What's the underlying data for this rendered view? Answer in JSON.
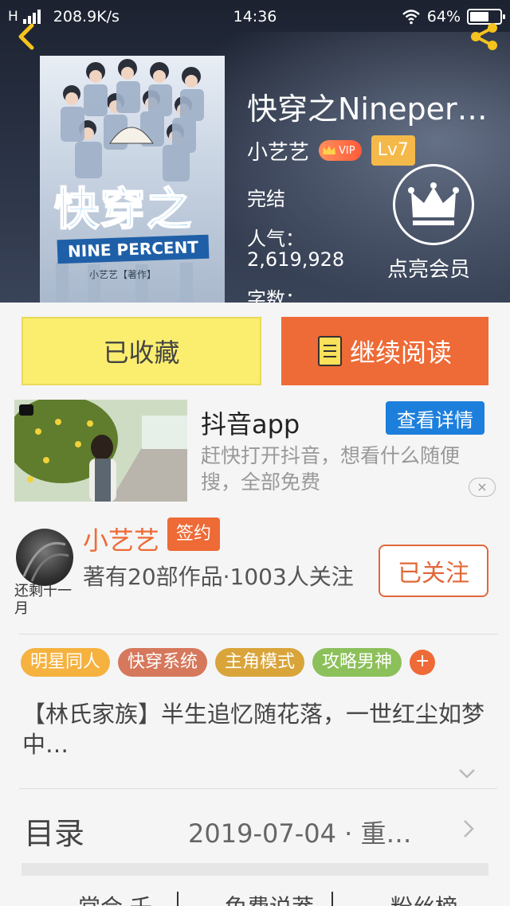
{
  "status_bar": {
    "network": "H",
    "speed": "208.9K/s",
    "time": "14:36",
    "battery": "64%",
    "battery_level": 0.64
  },
  "header": {
    "back_icon": "chevron-left-icon",
    "share_icon": "share-icon",
    "cover": {
      "title": "快穿之",
      "band": "NINE PERCENT",
      "author": "小艺艺【著作】"
    },
    "title": "快穿之Nineper…",
    "author": "小艺艺",
    "vip": "VIP",
    "level": "Lv7",
    "status": "完结",
    "popularity_label": "人气：",
    "popularity_value": "2,619,928",
    "word_count_label": "字数：",
    "member_icon": "crown-icon",
    "member_label": "点亮会员"
  },
  "actions": {
    "collected": "已收藏",
    "continue_reading": "继续阅读"
  },
  "ad": {
    "title": "抖音app",
    "detail_button": "查看详情",
    "description": "赶快打开抖音，想看什么随便搜，全部免费",
    "close": "×"
  },
  "author_card": {
    "name": "小艺艺",
    "sign_badge": "签约",
    "description": "著有20部作品·1003人关注",
    "follow_button": "已关注",
    "avatar_caption": "还剩十一月"
  },
  "tags": [
    "明星同人",
    "快穿系统",
    "主角模式",
    "攻略男神"
  ],
  "tag_add": "+",
  "tag_colors": [
    "#f5b23e",
    "#d6785c",
    "#d9a43a",
    "#8cc05a"
  ],
  "synopsis": "【林氏家族】半生追忆随花落，一世红尘如梦中…",
  "toc": {
    "label": "目录",
    "update": "2019-07-04 · 重…"
  },
  "bottom_tabs": [
    "常合 壬",
    "免费说莽",
    "粉丝榜"
  ],
  "colors": {
    "accent": "#ee6a36",
    "collect_bg": "#fbee6f",
    "ad_button": "#1d7fdc",
    "level_badge": "#f5b94a"
  }
}
